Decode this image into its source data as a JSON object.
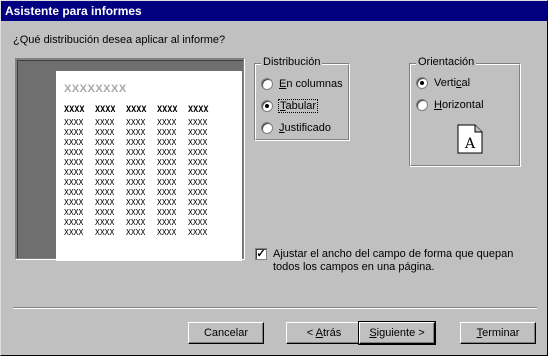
{
  "window": {
    "title": "Asistente para informes"
  },
  "prompt": "¿Qué distribución desea aplicar al informe?",
  "preview": {
    "title": "XXXXXXXX",
    "headers": [
      "XXXX",
      "XXXX",
      "XXXX",
      "XXXX",
      "XXXX"
    ],
    "cell": "XXXX",
    "row_count": 12
  },
  "distribution": {
    "label": "Distribución",
    "options": [
      {
        "pre": "",
        "key": "E",
        "post": "n columnas",
        "checked": false
      },
      {
        "pre": "",
        "key": "T",
        "post": "abular",
        "checked": true
      },
      {
        "pre": "",
        "key": "J",
        "post": "ustificado",
        "checked": false
      }
    ]
  },
  "orientation": {
    "label": "Orientación",
    "options": [
      {
        "pre": "Verti",
        "key": "c",
        "post": "al",
        "checked": true
      },
      {
        "pre": "",
        "key": "H",
        "post": "orizontal",
        "checked": false
      }
    ],
    "page_letter": "A"
  },
  "adjust": {
    "checked": true,
    "check_mark": "✓",
    "line1_pre": "A",
    "line1_key": "j",
    "line1_post": "ustar el ancho del campo de forma que quepan",
    "line2": "todos los campos en una página."
  },
  "buttons": {
    "cancel": "Cancelar",
    "back_pre": "< ",
    "back_key": "A",
    "back_post": "trás",
    "next_pre": "",
    "next_key": "S",
    "next_post": "iguiente >",
    "finish_pre": "",
    "finish_key": "T",
    "finish_post": "erminar"
  }
}
